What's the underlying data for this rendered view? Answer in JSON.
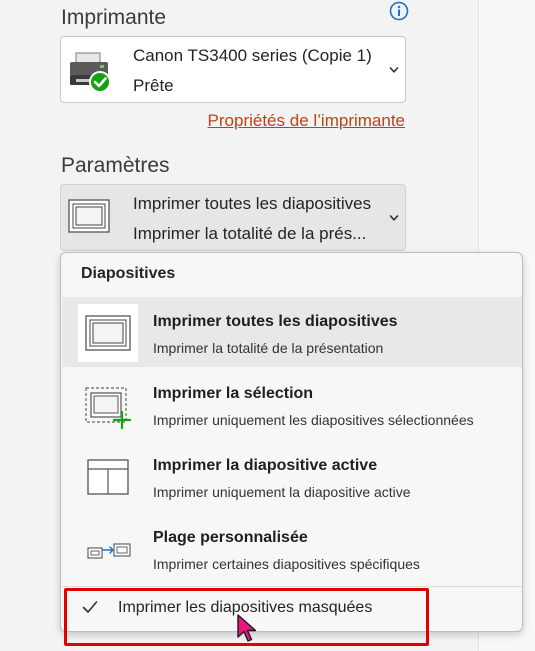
{
  "printer": {
    "section_title": "Imprimante",
    "name": "Canon TS3400 series (Copie 1)",
    "status": "Prête",
    "properties_link": "Propriétés de l’imprimante"
  },
  "settings": {
    "section_title": "Paramètres",
    "selected_title": "Imprimer toutes les diapositives",
    "selected_desc": "Imprimer la totalité de la prés..."
  },
  "menu": {
    "header": "Diapositives",
    "items": [
      {
        "title": "Imprimer toutes les diapositives",
        "desc": "Imprimer la totalité de la présentation",
        "icon": "all-slides-icon"
      },
      {
        "title": "Imprimer la sélection",
        "desc": "Imprimer uniquement les diapositives sélectionnées",
        "icon": "selection-icon"
      },
      {
        "title": "Imprimer la diapositive active",
        "desc": "Imprimer uniquement la diapositive active",
        "icon": "active-slide-icon"
      },
      {
        "title": "Plage personnalisée",
        "desc": "Imprimer certaines diapositives spécifiques",
        "icon": "custom-range-icon"
      }
    ],
    "hidden_slides_option": "Imprimer les diapositives masquées",
    "hidden_slides_checked": true
  },
  "colors": {
    "accent_link": "#c43e1c",
    "status_green": "#13a10e",
    "highlight_red": "#e00000",
    "cursor_pink": "#e8157f"
  }
}
